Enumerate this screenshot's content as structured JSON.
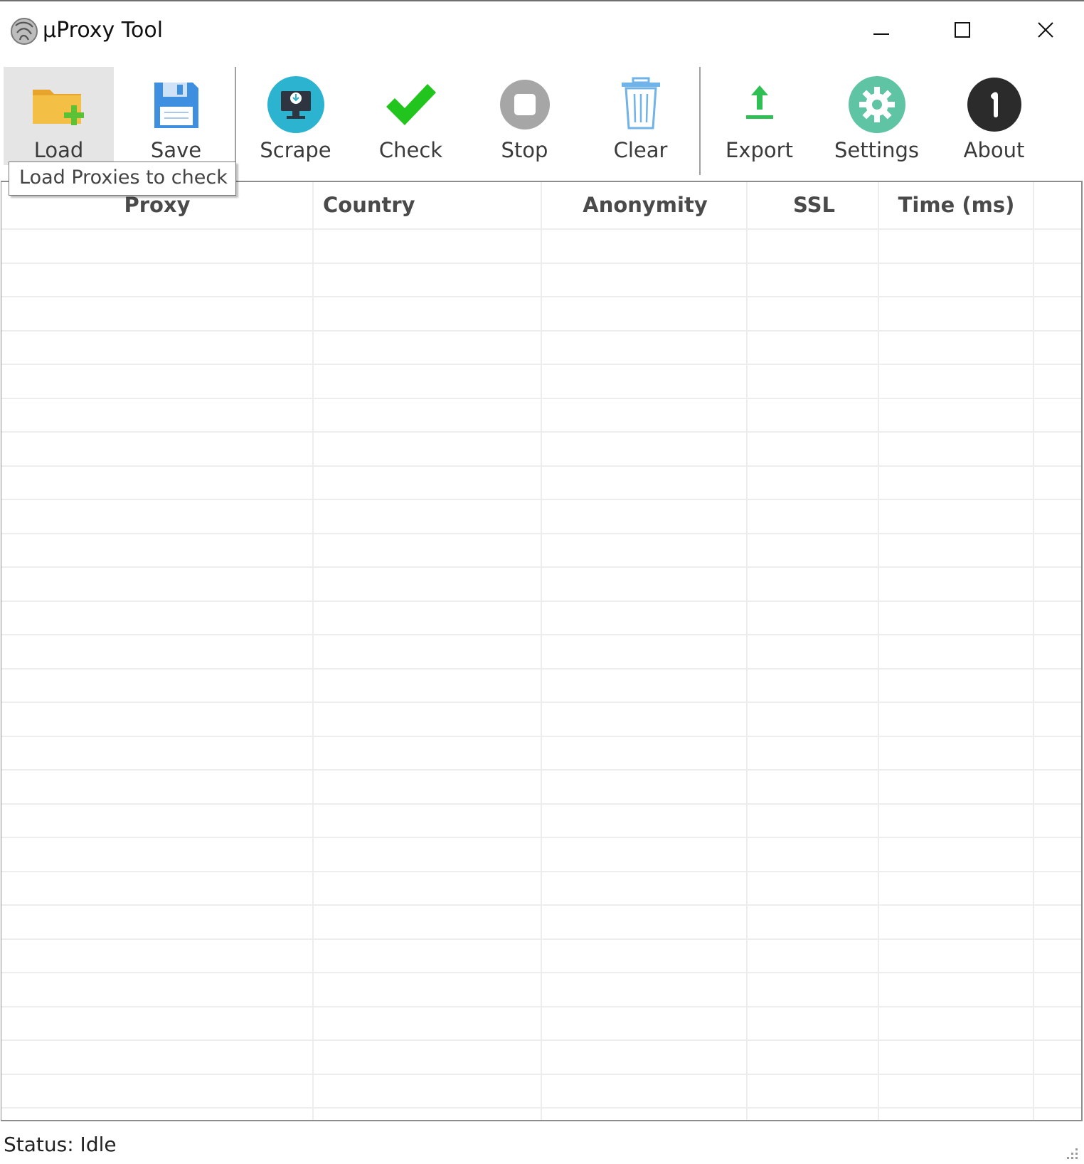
{
  "window": {
    "title": "µProxy Tool"
  },
  "toolbar": {
    "buttons": [
      {
        "label": "Load",
        "icon": "folder-add-icon"
      },
      {
        "label": "Save",
        "icon": "floppy-disk-icon"
      },
      {
        "label": "Scrape",
        "icon": "monitor-download-icon"
      },
      {
        "label": "Check",
        "icon": "checkmark-icon"
      },
      {
        "label": "Stop",
        "icon": "stop-icon"
      },
      {
        "label": "Clear",
        "icon": "trash-icon"
      },
      {
        "label": "Export",
        "icon": "upload-arrow-icon"
      },
      {
        "label": "Settings",
        "icon": "gear-icon"
      },
      {
        "label": "About",
        "icon": "info-icon"
      }
    ]
  },
  "tooltip": {
    "text": "Load Proxies to check"
  },
  "grid": {
    "columns": [
      "Proxy",
      "Country",
      "Anonymity",
      "SSL",
      "Time (ms)"
    ],
    "rows": []
  },
  "status": {
    "text": "Status: Idle"
  },
  "colors": {
    "scrape": "#2bb3cf",
    "check": "#22c51e",
    "stop": "#a6a6a6",
    "clear": "#6fb3e8",
    "export": "#2fbf55",
    "settings": "#5fc4a4",
    "about": "#2b2b2b",
    "save": "#3f8fe0",
    "load_folder": "#f0b43c",
    "load_plus": "#5bc236"
  }
}
